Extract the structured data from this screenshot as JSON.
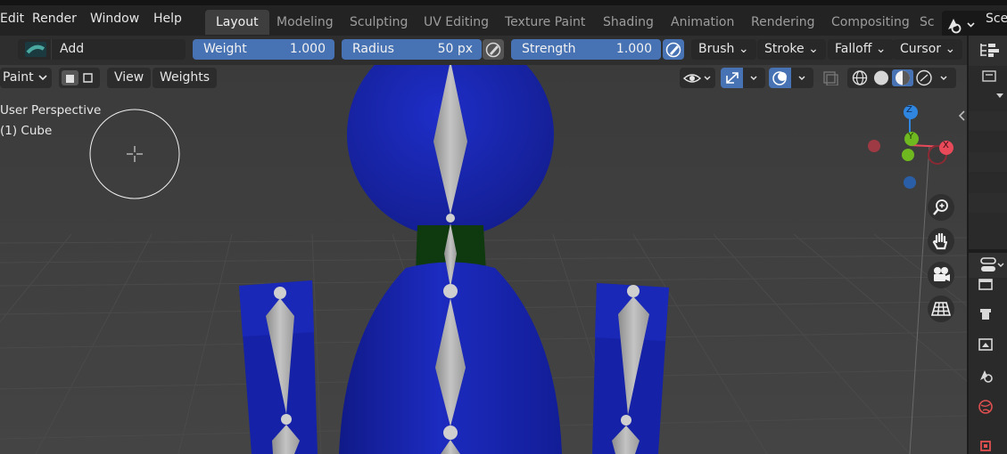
{
  "menubar": {
    "items": [
      "Edit",
      "Render",
      "Window",
      "Help"
    ],
    "workspace_tabs": [
      "Layout",
      "Modeling",
      "Sculpting",
      "UV Editing",
      "Texture Paint",
      "Shading",
      "Animation",
      "Rendering",
      "Compositing",
      "Sc"
    ],
    "active_tab": "Layout",
    "scene_label": "Sce"
  },
  "tool_header": {
    "brush_name": "Add",
    "weight": {
      "label": "Weight",
      "value": "1.000"
    },
    "radius": {
      "label": "Radius",
      "value": "50 px"
    },
    "strength": {
      "label": "Strength",
      "value": "1.000"
    },
    "dropdowns": [
      "Brush",
      "Stroke",
      "Falloff",
      "Cursor"
    ]
  },
  "viewport_header": {
    "mode": "Paint",
    "menus": [
      "View",
      "Weights"
    ]
  },
  "viewport": {
    "perspective_label": "User Perspective",
    "object_label": "(1) Cube",
    "gizmo_axes": {
      "z": "Z",
      "y": "Y",
      "x": "X"
    }
  },
  "icons": [
    "brush-thumbnail-icon",
    "visibility-icon",
    "gizmo-icon",
    "overlay-icon",
    "xray-icon",
    "wireframe-shading-icon",
    "solid-shading-icon",
    "material-shading-icon",
    "rendered-shading-icon",
    "zoom-icon",
    "pan-hand-icon",
    "camera-icon",
    "grid-view-icon",
    "outliner-icon",
    "properties-icon",
    "tool-properties-icon",
    "render-properties-icon",
    "output-properties-icon",
    "view-layer-icon",
    "scene-properties-icon",
    "world-properties-icon",
    "object-properties-icon"
  ],
  "colors": {
    "accent_blue": "#4772b3",
    "mesh_blue": "#1a27b0",
    "neck_green": "#0f3a0f",
    "bone_gray": "#a6a6a6",
    "axis_x": "#e84a5a",
    "axis_y": "#6fb820",
    "axis_z": "#2f86e0"
  }
}
